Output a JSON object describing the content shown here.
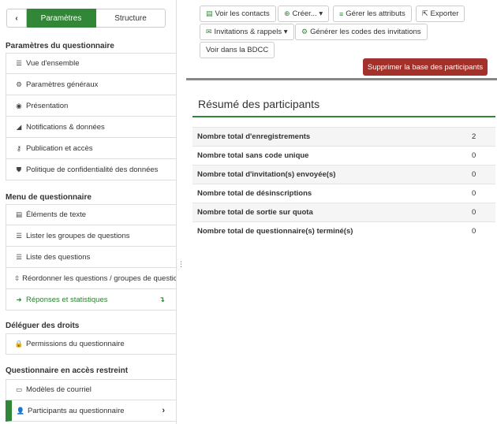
{
  "sidebar": {
    "tabs": {
      "params": "Paramètres",
      "structure": "Structure"
    },
    "back": "‹",
    "sections": [
      {
        "title": "Paramètres du questionnaire",
        "items": [
          {
            "label": "Vue d'ensemble",
            "icon": "list-icon",
            "glyph": "☰"
          },
          {
            "label": "Paramètres généraux",
            "icon": "cogs-icon",
            "glyph": "⚙"
          },
          {
            "label": "Présentation",
            "icon": "eye-slash-icon",
            "glyph": "◉"
          },
          {
            "label": "Notifications & données",
            "icon": "rss-icon",
            "glyph": "◢"
          },
          {
            "label": "Publication et accès",
            "icon": "key-icon",
            "glyph": "⚷"
          },
          {
            "label": "Politique de confidentialité des données",
            "icon": "shield-icon",
            "glyph": "⛊"
          }
        ]
      },
      {
        "title": "Menu de questionnaire",
        "items": [
          {
            "label": "Éléments de texte",
            "icon": "file-text-icon",
            "glyph": "▤"
          },
          {
            "label": "Lister les groupes de questions",
            "icon": "list-icon",
            "glyph": "☰"
          },
          {
            "label": "Liste des questions",
            "icon": "list-icon",
            "glyph": "☰"
          },
          {
            "label": "Réordonner les questions / groupes de questions",
            "icon": "reorder-icon",
            "glyph": "⇳"
          },
          {
            "label": "Réponses et statistiques",
            "icon": "arrow-right-icon",
            "glyph": "➜",
            "chev": "↴"
          }
        ]
      },
      {
        "title": "Déléguer des droits",
        "items": [
          {
            "label": "Permissions du questionnaire",
            "icon": "lock-icon",
            "glyph": "🔒"
          }
        ]
      },
      {
        "title": "Questionnaire en accès restreint",
        "items": [
          {
            "label": "Modèles de courriel",
            "icon": "envelope-icon",
            "glyph": "▭"
          },
          {
            "label": "Participants au questionnaire",
            "icon": "user-icon",
            "glyph": "👤",
            "chev": "›"
          }
        ]
      }
    ]
  },
  "toolbar": {
    "view_contacts": "Voir les contacts",
    "create": "Créer... ▾",
    "manage_attributes": "Gérer les attributs",
    "export": "Exporter",
    "invitations": "Invitations & rappels ▾",
    "generate_codes": "Générer les codes des invitations",
    "view_bdcc": "Voir dans la BDCC",
    "delete_db": "Supprimer la base des participants"
  },
  "summary": {
    "title": "Résumé des participants",
    "rows": [
      {
        "label": "Nombre total d'enregistrements",
        "value": "2"
      },
      {
        "label": "Nombre total sans code unique",
        "value": "0"
      },
      {
        "label": "Nombre total d'invitation(s) envoyée(s)",
        "value": "0"
      },
      {
        "label": "Nombre total de désinscriptions",
        "value": "0"
      },
      {
        "label": "Nombre total de sortie sur quota",
        "value": "0"
      },
      {
        "label": "Nombre total de questionnaire(s) terminé(s)",
        "value": "0"
      }
    ]
  },
  "colors": {
    "accent": "#328637",
    "danger": "#a2312b"
  }
}
